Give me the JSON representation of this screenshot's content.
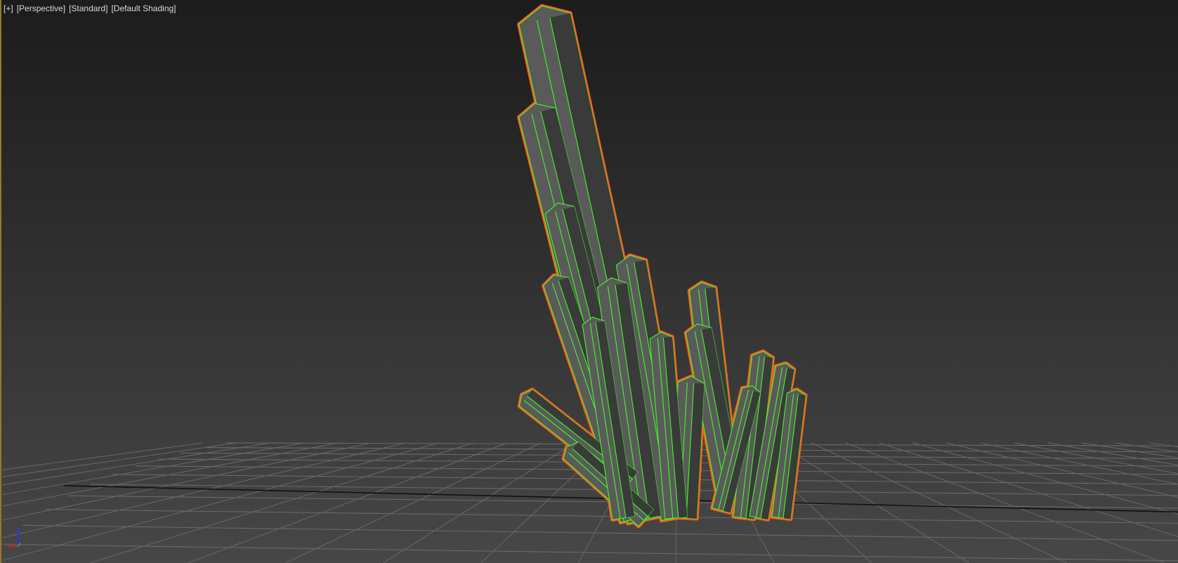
{
  "viewport": {
    "labels": {
      "plus": "[+]",
      "view": "[Perspective]",
      "mode": "[Standard]",
      "shading": "[Default Shading]"
    },
    "gizmo": {
      "z_label": "Z",
      "x_label": "X"
    },
    "colors": {
      "selection_outline": "#ff5a1e",
      "wire_edges": "#3cff20",
      "object_fill": "#5a5a5a",
      "active_border": "#9c7a1c"
    }
  }
}
